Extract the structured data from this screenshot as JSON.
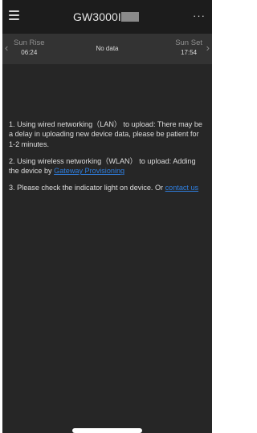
{
  "header": {
    "title": "GW3000I",
    "more_label": "···"
  },
  "sunbar": {
    "rise_label": "Sun Rise",
    "rise_time": "06:24",
    "status": "No data",
    "set_label": "Sun Set",
    "set_time": "17:54"
  },
  "instructions": {
    "p1": "1. Using wired networking（LAN） to upload: There may be a delay in uploading new device data, please be patient for 1-2 minutes.",
    "p2_prefix": "2. Using wireless networking（WLAN） to upload: Adding the device by ",
    "p2_link": "Gateway Provisioning",
    "p3_prefix": "3. Please check the indicator light on device. Or ",
    "p3_link": "contact us"
  },
  "colors": {
    "background": "#262626",
    "header": "#1c1c1c",
    "link": "#2f7fe0"
  }
}
